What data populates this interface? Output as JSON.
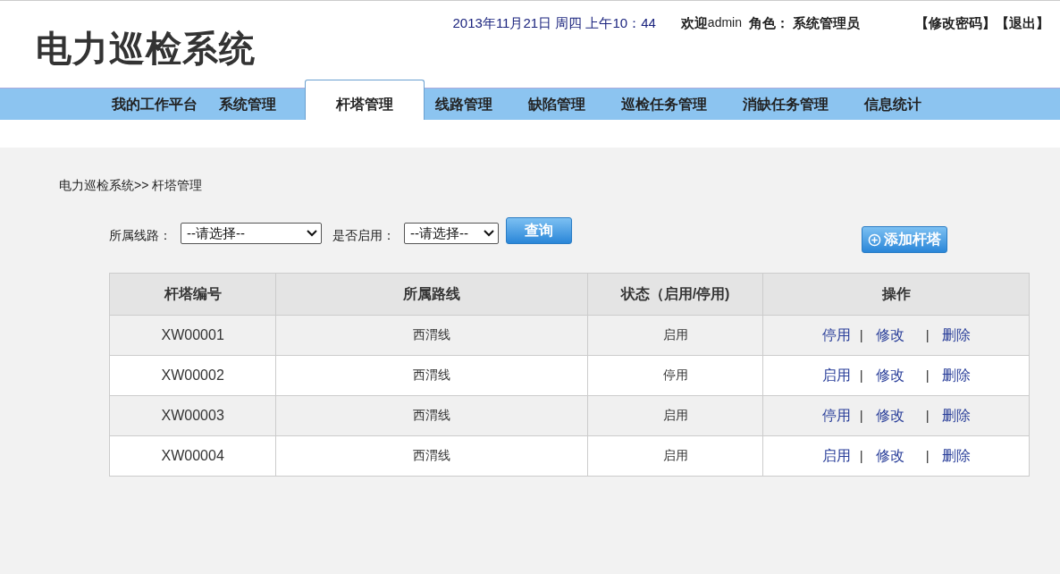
{
  "header": {
    "title": "电力巡检系统",
    "datetime": "2013年11月21日 周四 上午10：44",
    "welcome": "欢迎",
    "username": "admin",
    "role_label": "角色：",
    "role": "系统管理员",
    "links": [
      "【修改密码】",
      "【退出】"
    ]
  },
  "nav": [
    {
      "label": "我的工作平台",
      "selected": false
    },
    {
      "label": "系统管理",
      "selected": false
    },
    {
      "label": "杆塔管理",
      "selected": true
    },
    {
      "label": "线路管理",
      "selected": false
    },
    {
      "label": "缺陷管理",
      "selected": false
    },
    {
      "label": "巡检任务管理",
      "selected": false
    },
    {
      "label": "消缺任务管理",
      "selected": false
    },
    {
      "label": "信息统计",
      "selected": false
    }
  ],
  "breadcrumb": "电力巡检系统>>  杆塔管理",
  "filters": [
    {
      "label": "所属线路：",
      "value": "--请选择--"
    },
    {
      "label": "是否启用：",
      "value": "--请选择--"
    }
  ],
  "query_button": "查询",
  "add_button": "添加杆塔",
  "table": {
    "columns": [
      "杆塔编号",
      "所属路线",
      "状态（启用/停用)",
      "操作"
    ],
    "rows": [
      {
        "cells": [
          "XW00001",
          "西渭线",
          "启用"
        ],
        "actions": [
          "停用",
          "修改",
          "删除"
        ],
        "separators": [
          "|",
          "|"
        ]
      },
      {
        "cells": [
          "XW00002",
          "西渭线",
          "停用"
        ],
        "actions": [
          "启用",
          "修改",
          "删除"
        ],
        "separators": [
          "|",
          "|"
        ]
      },
      {
        "cells": [
          "XW00003",
          "西渭线",
          "启用"
        ],
        "actions": [
          "停用",
          "修改",
          "删除"
        ],
        "separators": [
          "|",
          "|"
        ]
      },
      {
        "cells": [
          "XW00004",
          "西渭线",
          "启用"
        ],
        "actions": [
          "启用",
          "修改",
          "删除"
        ],
        "separators": [
          "|",
          "|"
        ]
      }
    ]
  }
}
